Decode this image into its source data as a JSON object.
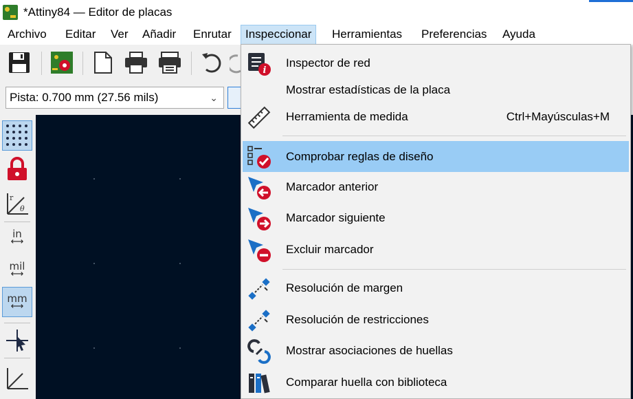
{
  "window": {
    "title": "*Attiny84 — Editor de placas"
  },
  "menubar": {
    "items": [
      {
        "label": "Archivo"
      },
      {
        "label": "Editar"
      },
      {
        "label": "Ver"
      },
      {
        "label": "Añadir"
      },
      {
        "label": "Enrutar"
      },
      {
        "label": "Inspeccionar"
      },
      {
        "label": "Herramientas"
      },
      {
        "label": "Preferencias"
      },
      {
        "label": "Ayuda"
      }
    ],
    "active": "Inspeccionar"
  },
  "toolbar": {
    "track_width": "Pista: 0.700 mm (27.56 mils)"
  },
  "left_toolbar": {
    "units": {
      "in": "in",
      "mil": "mil",
      "mm": "mm"
    }
  },
  "inspect_menu": {
    "items": [
      {
        "label": "Inspector de red",
        "icon": "net-inspector-icon",
        "shortcut": ""
      },
      {
        "label": "Mostrar estadísticas de la placa",
        "icon": "",
        "shortcut": ""
      },
      {
        "label": "Herramienta de medida",
        "icon": "measure-ruler-icon",
        "shortcut": "Ctrl+Mayúsculas+M"
      },
      {
        "label": "Comprobar reglas de diseño",
        "icon": "drc-checklist-icon",
        "shortcut": "",
        "highlighted": true
      },
      {
        "label": "Marcador anterior",
        "icon": "marker-previous-icon",
        "shortcut": ""
      },
      {
        "label": "Marcador siguiente",
        "icon": "marker-next-icon",
        "shortcut": ""
      },
      {
        "label": "Excluir marcador",
        "icon": "marker-exclude-icon",
        "shortcut": ""
      },
      {
        "label": "Resolución de margen",
        "icon": "clearance-resolution-icon",
        "shortcut": ""
      },
      {
        "label": "Resolución de restricciones",
        "icon": "constraints-resolution-icon",
        "shortcut": ""
      },
      {
        "label": "Mostrar asociaciones de huellas",
        "icon": "footprint-associations-icon",
        "shortcut": ""
      },
      {
        "label": "Comparar huella con biblioteca",
        "icon": "library-compare-icon",
        "shortcut": ""
      }
    ]
  },
  "colors": {
    "canvas_bg": "#001023",
    "menu_highlight": "#99ccf5",
    "marker_red": "#d0102a",
    "marker_blue": "#1b6fc6"
  }
}
